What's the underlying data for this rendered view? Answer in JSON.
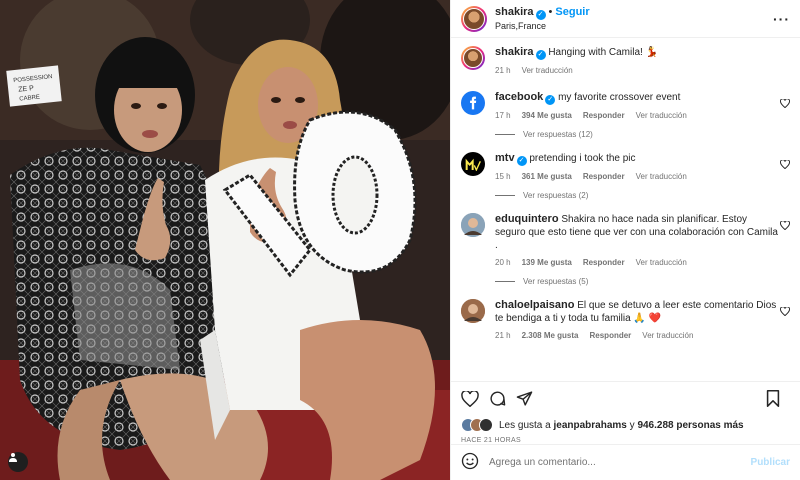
{
  "post": {
    "username": "shakira",
    "follow_label": "Seguir",
    "location": "Paris,France",
    "caption": "Hanging with Camila! 💃",
    "caption_time": "21 h",
    "caption_translate": "Ver traducción"
  },
  "comments": [
    {
      "user": "facebook",
      "verified": true,
      "text": "my favorite crossover event",
      "time": "17 h",
      "likes": "394 Me gusta",
      "reply": "Responder",
      "translate": "Ver traducción",
      "replies": "Ver respuestas (12)",
      "avatar_color": "#1877f2",
      "avatar_glyph": "f"
    },
    {
      "user": "mtv",
      "verified": true,
      "text": "pretending i took the pic",
      "time": "15 h",
      "likes": "361 Me gusta",
      "reply": "Responder",
      "translate": "Ver traducción",
      "replies": "Ver respuestas (2)",
      "avatar_color": "#000000",
      "avatar_glyph": "M"
    },
    {
      "user": "eduquintero",
      "verified": false,
      "text": "Shakira no hace nada sin planificar. Estoy seguro que esto tiene que ver con una colaboración con Camila .",
      "time": "20 h",
      "likes": "139 Me gusta",
      "reply": "Responder",
      "translate": "Ver traducción",
      "replies": "Ver respuestas (5)",
      "avatar_color": "#8aa3b8",
      "avatar_glyph": ""
    },
    {
      "user": "chaloelpaisano",
      "verified": false,
      "text": "El que se detuvo a leer este comentario Dios te bendiga a ti y toda tu familia 🙏 ❤️",
      "time": "21 h",
      "likes": "2.308 Me gusta",
      "reply": "Responder",
      "translate": "Ver traducción",
      "replies": "",
      "avatar_color": "#9a6a4a",
      "avatar_glyph": ""
    }
  ],
  "likes": {
    "prefix": "Les gusta a",
    "user": "jeanpabrahams",
    "joiner": "y",
    "count": "946.288 personas más"
  },
  "timestamp": "HACE 21 HORAS",
  "composer": {
    "placeholder": "Agrega un comentario...",
    "publish": "Publicar"
  },
  "photo_sign": {
    "line1": "POSSESSION",
    "line2": "ZE P",
    "line3": "CABRE"
  },
  "colors": {
    "accent": "#0095f6",
    "heart": "#ed4956"
  }
}
